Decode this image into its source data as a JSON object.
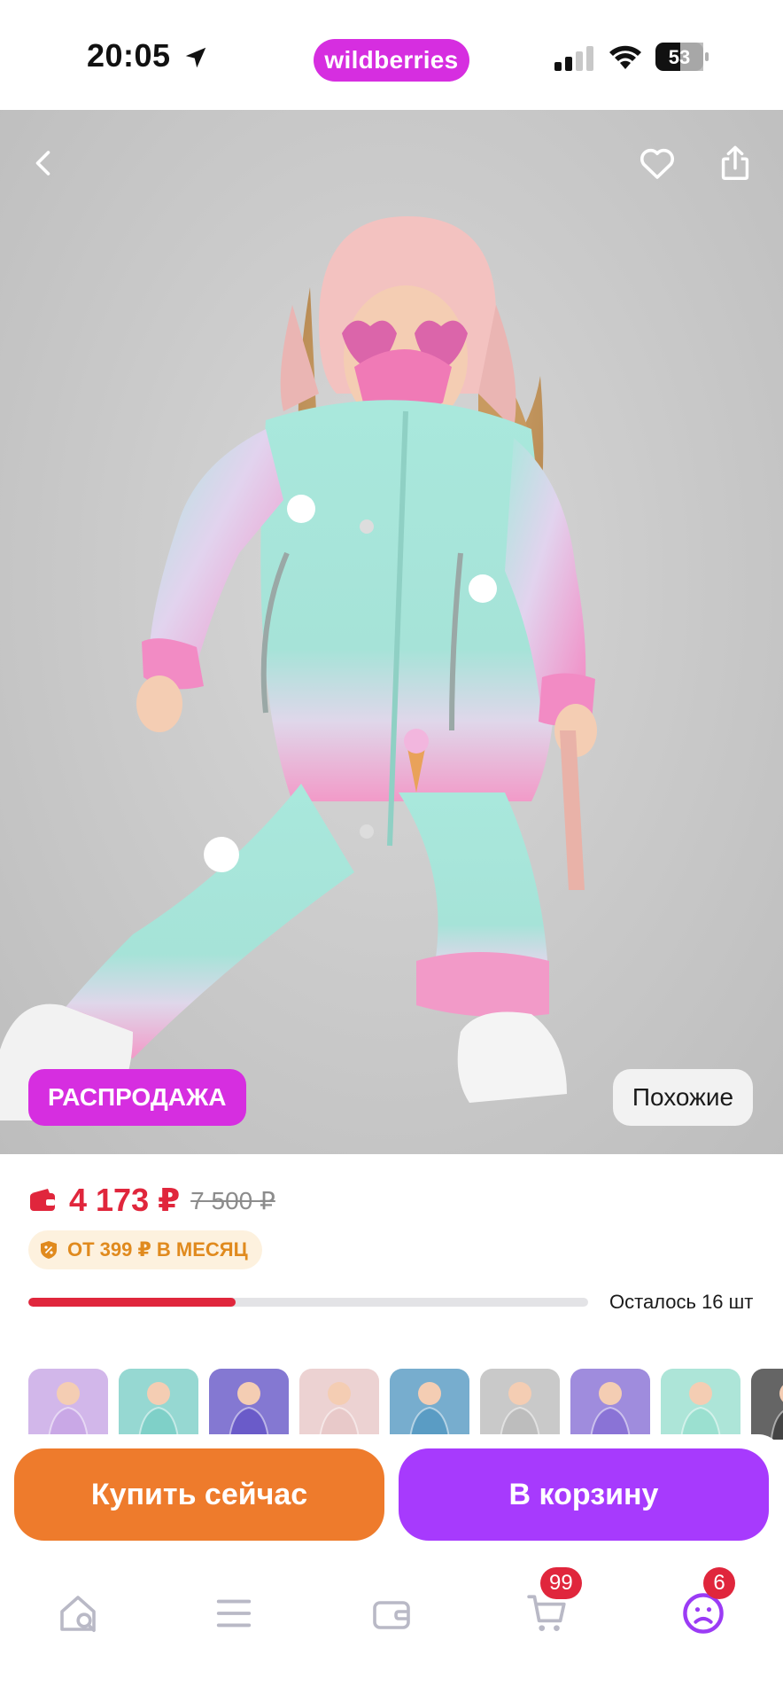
{
  "status_bar": {
    "time": "20:05",
    "brand": "wildberries",
    "battery": "53"
  },
  "hero": {
    "sale_badge": "РАСПРОДАЖА",
    "similar_button": "Похожие"
  },
  "price": {
    "current": "4 173 ₽",
    "old": "7 500 ₽",
    "installment": "ОТ 399 ₽ В МЕСЯЦ",
    "stock_text": "Осталось 16 шт",
    "stock_fraction": 0.37
  },
  "thumbnails": [
    {
      "name": "thumb-1",
      "color": "#c9a8e6"
    },
    {
      "name": "thumb-2",
      "color": "#7fd0c8"
    },
    {
      "name": "thumb-3",
      "color": "#6a5bc9"
    },
    {
      "name": "thumb-4",
      "color": "#e8c9c9"
    },
    {
      "name": "thumb-5",
      "color": "#5a9cc4"
    },
    {
      "name": "thumb-6",
      "color": "#bdbdbd"
    },
    {
      "name": "thumb-7",
      "color": "#8a73d6"
    },
    {
      "name": "thumb-8",
      "color": "#9be0d0"
    },
    {
      "name": "thumb-9",
      "color": "#444444"
    }
  ],
  "actions": {
    "buy_now": "Купить сейчас",
    "to_cart": "В корзину"
  },
  "bottom_nav": {
    "cart_badge": "99",
    "profile_badge": "6"
  },
  "colors": {
    "brand": "#d62ee0",
    "price": "#e0263c",
    "buy_now": "#ee7b2c",
    "to_cart": "#a73afd",
    "installment": "#e08a1e"
  }
}
